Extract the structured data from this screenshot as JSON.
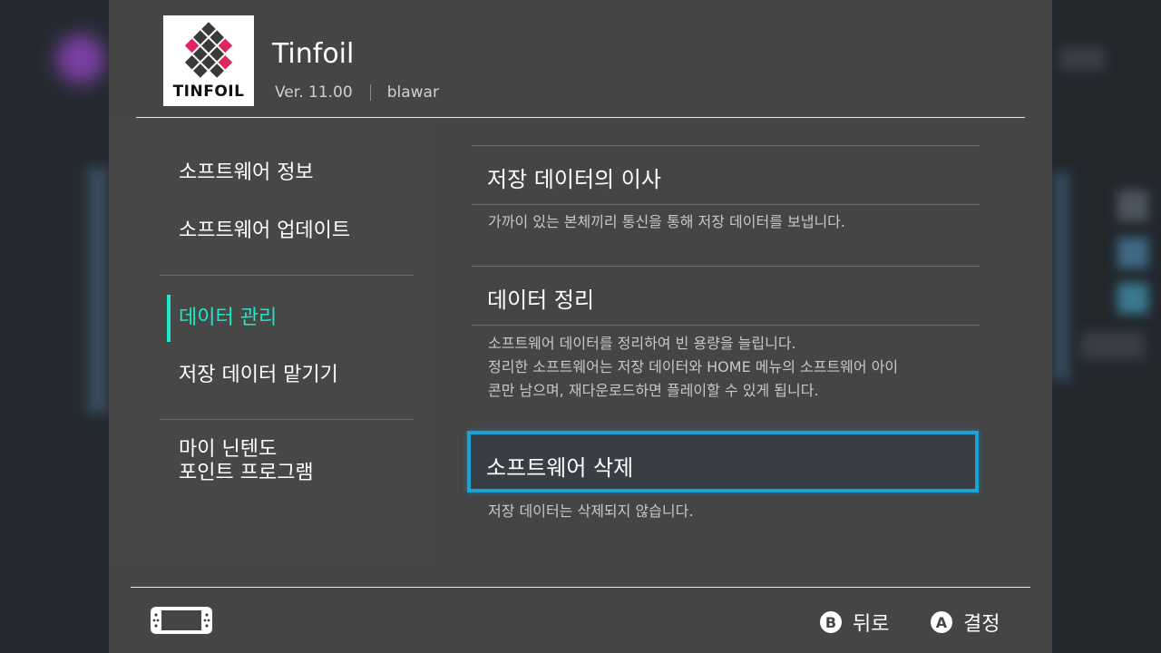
{
  "app": {
    "title": "Tinfoil",
    "version": "Ver. 11.00",
    "publisher": "blawar",
    "logo_text": "TINFOIL"
  },
  "sidebar": {
    "items": [
      {
        "label": "소프트웨어 정보"
      },
      {
        "label": "소프트웨어 업데이트"
      },
      {
        "label": "데이터 관리",
        "active": true
      },
      {
        "label": "저장 데이터 맡기기"
      },
      {
        "label_line1": "마이 닌텐도",
        "label_line2": "포인트 프로그램"
      }
    ]
  },
  "main": {
    "sections": [
      {
        "title": "저장 데이터의 이사",
        "description": [
          "가까이 있는 본체끼리 통신을 통해 저장 데이터를 보냅니다."
        ]
      },
      {
        "title": "데이터 정리",
        "description": [
          "소프트웨어 데이터를 정리하여 빈 용량을 늘립니다.",
          "정리한 소프트웨어는 저장 데이터와 HOME 메뉴의 소프트웨어 아이",
          "콘만 남으며, 재다운로드하면 플레이할 수 있게 됩니다."
        ]
      },
      {
        "title": "소프트웨어 삭제",
        "description": [
          "저장 데이터는 삭제되지 않습니다."
        ],
        "selected": true
      }
    ]
  },
  "footer": {
    "back": {
      "glyph": "B",
      "label": "뒤로"
    },
    "confirm": {
      "glyph": "A",
      "label": "결정"
    }
  },
  "colors": {
    "accent_teal": "#1ee8c8",
    "selection_blue": "#1aa3d6",
    "panel": "#454545",
    "logo_pink": "#e0245e",
    "logo_dark": "#3a3a3a"
  }
}
